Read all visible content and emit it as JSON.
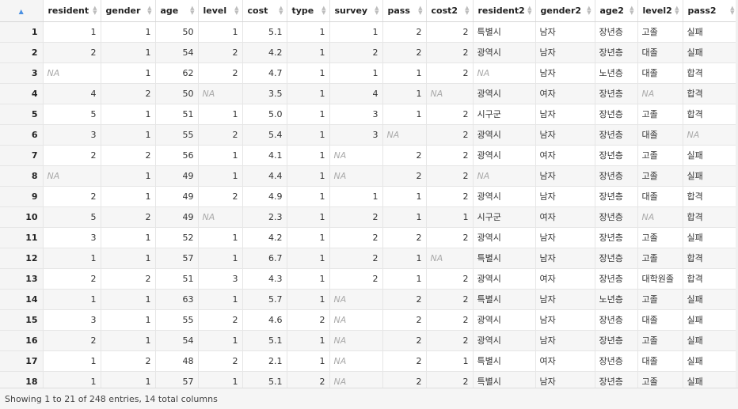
{
  "table": {
    "sort_indicator": "▲",
    "columns": [
      {
        "key": "resident",
        "label": "resident",
        "type": "num"
      },
      {
        "key": "gender",
        "label": "gender",
        "type": "num"
      },
      {
        "key": "age",
        "label": "age",
        "type": "num"
      },
      {
        "key": "level",
        "label": "level",
        "type": "num"
      },
      {
        "key": "cost",
        "label": "cost",
        "type": "num"
      },
      {
        "key": "type",
        "label": "type",
        "type": "num"
      },
      {
        "key": "survey",
        "label": "survey",
        "type": "num"
      },
      {
        "key": "pass",
        "label": "pass",
        "type": "num"
      },
      {
        "key": "cost2",
        "label": "cost2",
        "type": "num"
      },
      {
        "key": "resident2",
        "label": "resident2",
        "type": "str"
      },
      {
        "key": "gender2",
        "label": "gender2",
        "type": "str"
      },
      {
        "key": "age2",
        "label": "age2",
        "type": "str"
      },
      {
        "key": "level2",
        "label": "level2",
        "type": "str"
      },
      {
        "key": "pass2",
        "label": "pass2",
        "type": "str"
      }
    ],
    "rows": [
      {
        "index": "1",
        "cells": [
          "1",
          "1",
          "50",
          "1",
          "5.1",
          "1",
          "1",
          "2",
          "2",
          "특별시",
          "남자",
          "장년층",
          "고졸",
          "실패"
        ]
      },
      {
        "index": "2",
        "cells": [
          "2",
          "1",
          "54",
          "2",
          "4.2",
          "1",
          "2",
          "2",
          "2",
          "광역시",
          "남자",
          "장년층",
          "대졸",
          "실패"
        ]
      },
      {
        "index": "3",
        "cells": [
          "NA",
          "1",
          "62",
          "2",
          "4.7",
          "1",
          "1",
          "1",
          "2",
          "NA",
          "남자",
          "노년층",
          "대졸",
          "합격"
        ]
      },
      {
        "index": "4",
        "cells": [
          "4",
          "2",
          "50",
          "NA",
          "3.5",
          "1",
          "4",
          "1",
          "NA",
          "광역시",
          "여자",
          "장년층",
          "NA",
          "합격"
        ]
      },
      {
        "index": "5",
        "cells": [
          "5",
          "1",
          "51",
          "1",
          "5.0",
          "1",
          "3",
          "1",
          "2",
          "시구군",
          "남자",
          "장년층",
          "고졸",
          "합격"
        ]
      },
      {
        "index": "6",
        "cells": [
          "3",
          "1",
          "55",
          "2",
          "5.4",
          "1",
          "3",
          "NA",
          "2",
          "광역시",
          "남자",
          "장년층",
          "대졸",
          "NA"
        ]
      },
      {
        "index": "7",
        "cells": [
          "2",
          "2",
          "56",
          "1",
          "4.1",
          "1",
          "NA",
          "2",
          "2",
          "광역시",
          "여자",
          "장년층",
          "고졸",
          "실패"
        ]
      },
      {
        "index": "8",
        "cells": [
          "NA",
          "1",
          "49",
          "1",
          "4.4",
          "1",
          "NA",
          "2",
          "2",
          "NA",
          "남자",
          "장년층",
          "고졸",
          "실패"
        ]
      },
      {
        "index": "9",
        "cells": [
          "2",
          "1",
          "49",
          "2",
          "4.9",
          "1",
          "1",
          "1",
          "2",
          "광역시",
          "남자",
          "장년층",
          "대졸",
          "합격"
        ]
      },
      {
        "index": "10",
        "cells": [
          "5",
          "2",
          "49",
          "NA",
          "2.3",
          "1",
          "2",
          "1",
          "1",
          "시구군",
          "여자",
          "장년층",
          "NA",
          "합격"
        ]
      },
      {
        "index": "11",
        "cells": [
          "3",
          "1",
          "52",
          "1",
          "4.2",
          "1",
          "2",
          "2",
          "2",
          "광역시",
          "남자",
          "장년층",
          "고졸",
          "실패"
        ]
      },
      {
        "index": "12",
        "cells": [
          "1",
          "1",
          "57",
          "1",
          "6.7",
          "1",
          "2",
          "1",
          "NA",
          "특별시",
          "남자",
          "장년층",
          "고졸",
          "합격"
        ]
      },
      {
        "index": "13",
        "cells": [
          "2",
          "2",
          "51",
          "3",
          "4.3",
          "1",
          "2",
          "1",
          "2",
          "광역시",
          "여자",
          "장년층",
          "대학원졸",
          "합격"
        ]
      },
      {
        "index": "14",
        "cells": [
          "1",
          "1",
          "63",
          "1",
          "5.7",
          "1",
          "NA",
          "2",
          "2",
          "특별시",
          "남자",
          "노년층",
          "고졸",
          "실패"
        ]
      },
      {
        "index": "15",
        "cells": [
          "3",
          "1",
          "55",
          "2",
          "4.6",
          "2",
          "NA",
          "2",
          "2",
          "광역시",
          "남자",
          "장년층",
          "대졸",
          "실패"
        ]
      },
      {
        "index": "16",
        "cells": [
          "2",
          "1",
          "54",
          "1",
          "5.1",
          "1",
          "NA",
          "2",
          "2",
          "광역시",
          "남자",
          "장년층",
          "고졸",
          "실패"
        ]
      },
      {
        "index": "17",
        "cells": [
          "1",
          "2",
          "48",
          "2",
          "2.1",
          "1",
          "NA",
          "2",
          "1",
          "특별시",
          "여자",
          "장년층",
          "대졸",
          "실패"
        ]
      },
      {
        "index": "18",
        "cells": [
          "1",
          "1",
          "57",
          "1",
          "5.1",
          "2",
          "NA",
          "2",
          "2",
          "특별시",
          "남자",
          "장년층",
          "고졸",
          "실패"
        ]
      }
    ]
  },
  "footer": {
    "status": "Showing 1 to 21 of 248 entries, 14 total columns"
  }
}
